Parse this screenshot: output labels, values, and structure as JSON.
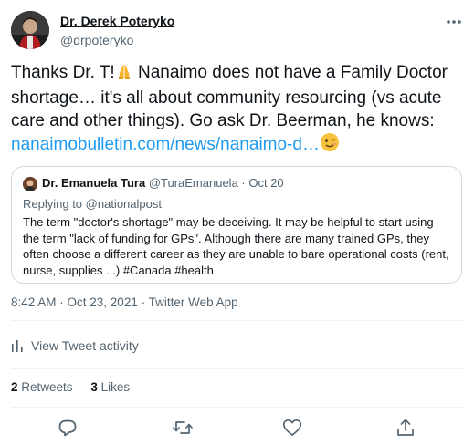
{
  "author": {
    "name": "Dr. Derek Poteryko",
    "handle": "@drpoteryko"
  },
  "tweet": {
    "text_before_emoji": "Thanks Dr. T!",
    "text_after_emoji": " Nanaimo does not have a Family Doctor shortage… it's all about community resourcing (vs acute care and other things). Go ask Dr. Beerman, he knows: ",
    "link": "nanaimobulletin.com/news/nanaimo-d…",
    "emoji_1": "folded-hands",
    "emoji_2": "winking-face"
  },
  "quote": {
    "name": "Dr. Emanuela Tura",
    "handle": "@TuraEmanuela",
    "separator": " · ",
    "date": "Oct 20",
    "replying_prefix": "Replying to ",
    "replying_to": "@nationalpost",
    "text": "The term \"doctor's shortage\" may be deceiving. It may be helpful to start using the term \"lack of funding for GPs\". Although there are many trained GPs, they often choose a different career as they are unable to bare operational costs (rent, nurse, supplies ...) #Canada #health"
  },
  "meta": {
    "timestamp": "8:42 AM · Oct 23, 2021 · Twitter Web App"
  },
  "activity": {
    "label": "View Tweet activity"
  },
  "stats": {
    "retweets_count": "2",
    "retweets_label": "Retweets",
    "likes_count": "3",
    "likes_label": "Likes"
  },
  "actions": [
    "reply-icon",
    "retweet-icon",
    "like-icon",
    "share-icon"
  ],
  "colors": {
    "text": "#0f1419",
    "secondary": "#536471",
    "link": "#1d9bf0",
    "border": "#cfd9de",
    "divider": "#eff3f4"
  }
}
